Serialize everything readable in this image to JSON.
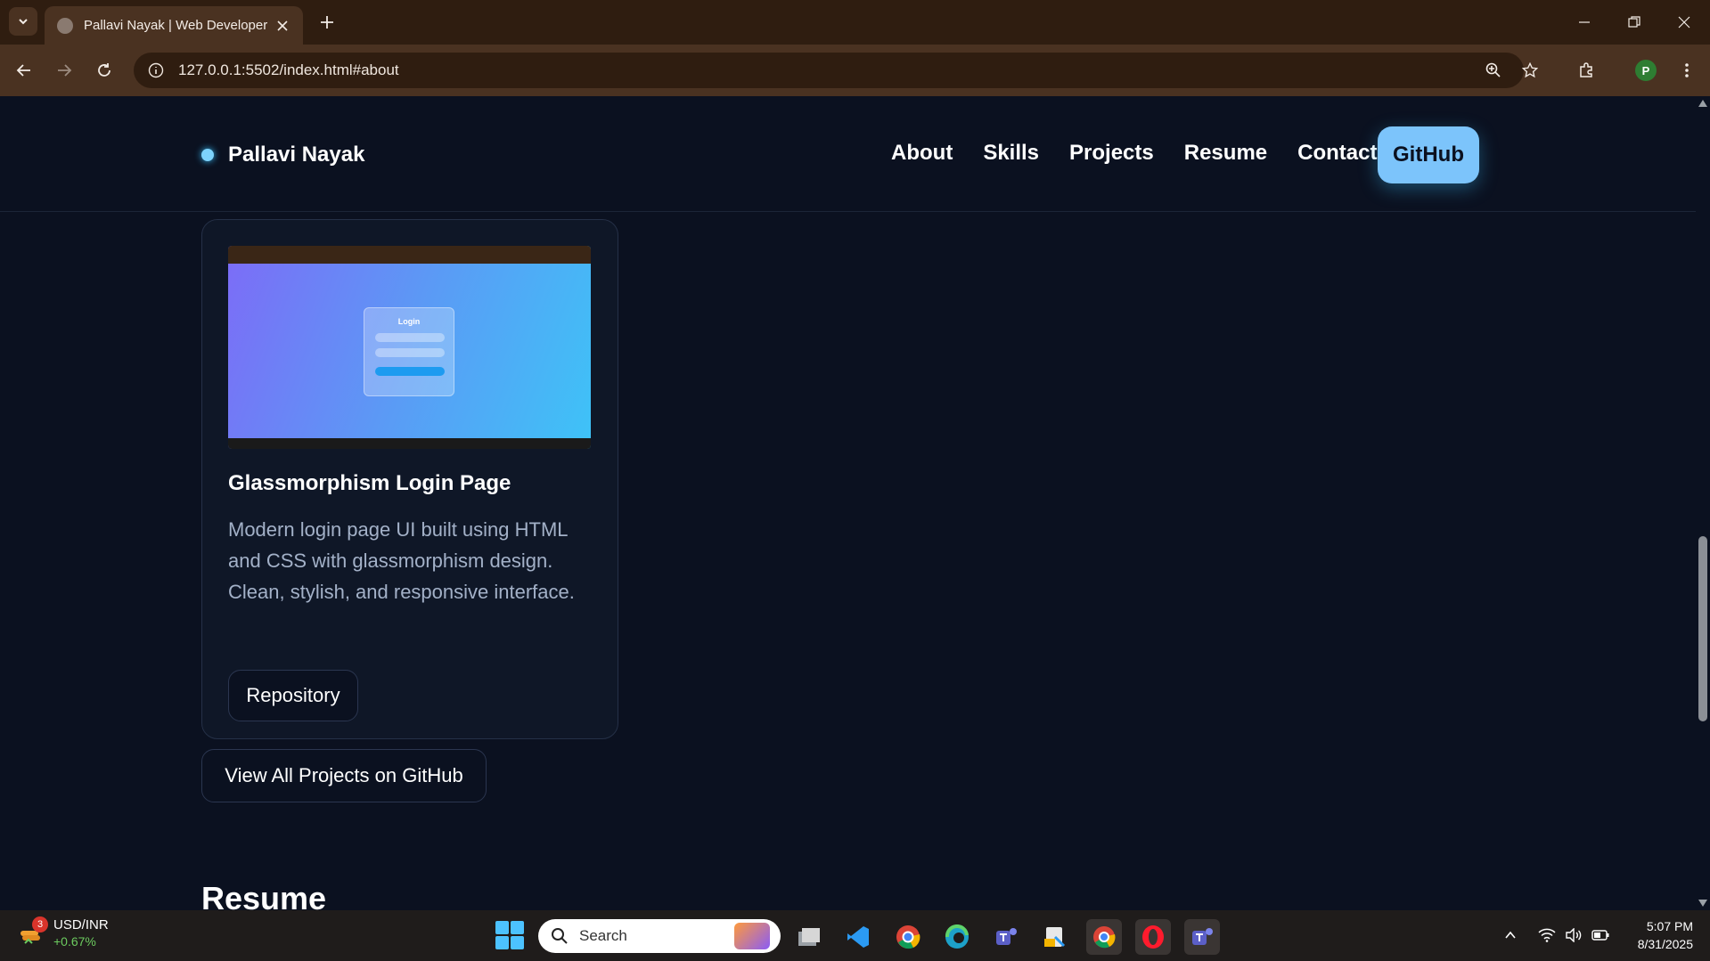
{
  "browser": {
    "tab_title": "Pallavi Nayak | Web Developer",
    "url": "127.0.0.1:5502/index.html#about",
    "profile_initial": "P"
  },
  "site": {
    "brand": "Pallavi Nayak",
    "nav": [
      "About",
      "Skills",
      "Projects",
      "Resume",
      "Contact"
    ],
    "github_button": "GitHub",
    "accent": "#7cc4fb"
  },
  "project_card": {
    "screenshot_label": "Login",
    "title": "Glassmorphism Login Page",
    "description": "Modern login page UI built using HTML and CSS with glassmorphism design. Clean, stylish, and responsive interface.",
    "repo_button": "Repository"
  },
  "view_all_button": "View All Projects on GitHub",
  "next_section_heading": "Resume",
  "taskbar": {
    "widget_badge": "3",
    "widget_label": "USD/INR",
    "widget_change": "+0.67%",
    "search_placeholder": "Search",
    "time": "5:07 PM",
    "date": "8/31/2025"
  }
}
